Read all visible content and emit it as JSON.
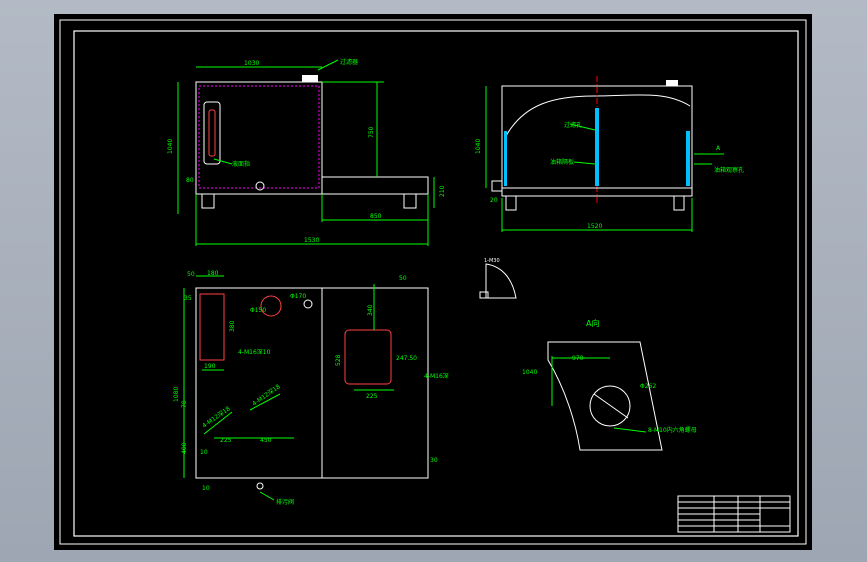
{
  "colors": {
    "background": "#000000",
    "outline": "#ffffff",
    "dimension": "#00ff00",
    "hidden": "#ff00ff",
    "centerline": "#ff0000",
    "section": "#00bfff"
  },
  "front_view": {
    "label_filter": "过滤器",
    "label_gauge": "液面指",
    "dim_width_top": "1030",
    "dim_height": "1040",
    "dim_gap": "750",
    "dim_step": "850",
    "dim_total": "1530",
    "dim_base": "210",
    "dim_left": "80"
  },
  "side_view": {
    "label_filter_hole": "过滤孔",
    "label_oil_plate": "油箱隔板",
    "label_oil_hole": "油箱观察孔",
    "label_a": "A",
    "dim_height": "1040",
    "dim_base": "20",
    "dim_width": "1520"
  },
  "top_view": {
    "dim_50": "50",
    "dim_180": "180",
    "dim_35": "35",
    "dim_phi170": "Φ170",
    "dim_phi150": "Φ150",
    "dim_380": "380",
    "dim_4_m16": "4-M16深10",
    "dim_190": "190",
    "dim_50b": "50",
    "dim_340": "340",
    "dim_528": "528",
    "dim_247": "247.50",
    "dim_4_m16b": "4-M16深",
    "dim_225": "225",
    "dim_1080": "1080",
    "dim_4_m12_a": "4-M12深18",
    "dim_4_m12_b": "4-M12深18",
    "dim_70": "70",
    "dim_225b": "225",
    "dim_450": "450",
    "dim_400": "400",
    "dim_10": "10",
    "dim_10b": "10",
    "dim_30": "30",
    "label_drain": "排污阀"
  },
  "view_a": {
    "title": "A向",
    "dim_970": "970",
    "dim_1040": "1040",
    "dim_phi262": "Φ262",
    "label_bolts": "8-M10内六角螺母"
  },
  "small_detail": {
    "label": "1-M30"
  }
}
